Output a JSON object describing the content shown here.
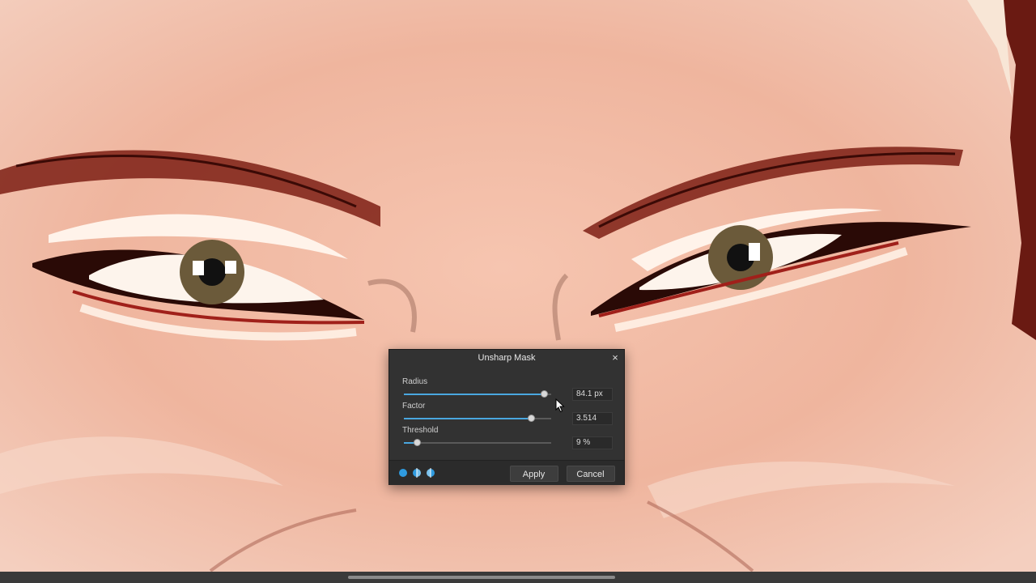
{
  "dialog": {
    "title": "Unsharp Mask",
    "close_glyph": "×",
    "parameters": [
      {
        "label": "Radius",
        "value": "84.1 px",
        "slider_fraction": 0.95
      },
      {
        "label": "Factor",
        "value": "3.514",
        "slider_fraction": 0.86
      },
      {
        "label": "Threshold",
        "value": "9 %",
        "slider_fraction": 0.09
      }
    ],
    "preview_modes": [
      "preview-full-icon",
      "preview-split-icon",
      "preview-mirror-icon"
    ],
    "apply_label": "Apply",
    "cancel_label": "Cancel"
  },
  "colors": {
    "dialog_bg": "#323232",
    "accent": "#4aa7df"
  }
}
